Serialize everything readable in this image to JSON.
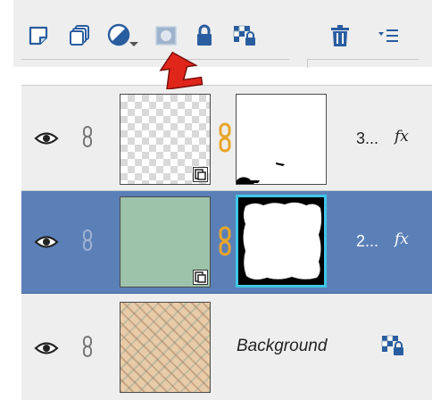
{
  "toolbar": {
    "tools": [
      {
        "icon": "new-layer-icon"
      },
      {
        "icon": "new-group-icon"
      },
      {
        "icon": "adjustment-layer-icon"
      },
      {
        "icon": "add-layer-mask-icon"
      },
      {
        "icon": "lock-all-icon"
      },
      {
        "icon": "lock-transparent-icon"
      },
      {
        "icon": "trash-icon"
      },
      {
        "icon": "panel-menu-icon"
      }
    ]
  },
  "annotation": {
    "icon": "red-arrow-icon",
    "color": "#e0251b"
  },
  "layers": [
    {
      "name": "3...",
      "fx": "fx",
      "thumbnail": "transparent-checker",
      "mask": "white-mask",
      "selected": false
    },
    {
      "name": "2...",
      "fx": "fx",
      "thumbnail": "mint-paper",
      "mask": "deckled-white-mask",
      "selected": true
    },
    {
      "name": "Background",
      "thumbnail": "plaid-paper",
      "locked": true,
      "selected": false
    }
  ],
  "colors": {
    "selected_row": "#5b80b8",
    "mask_highlight": "#3ec6e6",
    "panel_bg": "#eeeeee"
  }
}
